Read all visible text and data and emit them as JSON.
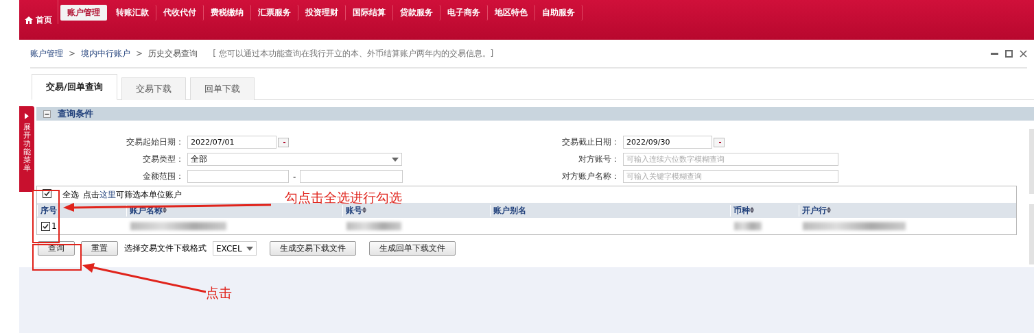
{
  "nav": {
    "home": "首页",
    "items": [
      {
        "label": "账户管理",
        "selected": true
      },
      {
        "label": "转账汇款",
        "selected": false
      },
      {
        "label": "代收代付",
        "selected": false
      },
      {
        "label": "费税缴纳",
        "selected": false
      },
      {
        "label": "汇票服务",
        "selected": false
      },
      {
        "label": "投资理财",
        "selected": false
      },
      {
        "label": "国际结算",
        "selected": false
      },
      {
        "label": "贷款服务",
        "selected": false
      },
      {
        "label": "电子商务",
        "selected": false
      },
      {
        "label": "地区特色",
        "selected": false
      },
      {
        "label": "自助服务",
        "selected": false
      }
    ]
  },
  "breadcrumb": {
    "items": [
      {
        "label": "账户管理",
        "link": true
      },
      {
        "label": "境内中行账户",
        "link": true
      },
      {
        "label": "历史交易查询",
        "link": false
      }
    ],
    "separators": [
      ">",
      ">"
    ],
    "hint": "[ 您可以通过本功能查询在我行开立的本、外币结算账户两年内的交易信息。]"
  },
  "tabs": [
    {
      "label": "交易/回单查询",
      "selected": true
    },
    {
      "label": "交易下载",
      "selected": false
    },
    {
      "label": "回单下载",
      "selected": false
    }
  ],
  "side_menu": {
    "label": "展开功能菜单"
  },
  "section": {
    "title": "查询条件"
  },
  "left_fields": [
    {
      "kind": "date",
      "label": "交易起始日期：",
      "value": "2022/07/01"
    },
    {
      "kind": "select",
      "label": "交易类型：",
      "value": "全部"
    },
    {
      "kind": "range",
      "label": "金额范围：",
      "separator": "-"
    }
  ],
  "right_fields": [
    {
      "kind": "date",
      "label": "交易截止日期：",
      "value": "2022/09/30"
    },
    {
      "kind": "text",
      "label": "对方账号：",
      "placeholder": "可输入连续六位数字模糊查询"
    },
    {
      "kind": "text",
      "label": "对方账户名称：",
      "placeholder": "可输入关键字模糊查询"
    }
  ],
  "accounts": {
    "select_all": {
      "label": "全选",
      "checked": true
    },
    "note_before": "点击",
    "note_link": "这里",
    "note_after": "可筛选本单位账户",
    "columns": [
      {
        "label": "序号",
        "sortable": false
      },
      {
        "label": "账户名称",
        "sortable": true
      },
      {
        "label": "账号",
        "sortable": true
      },
      {
        "label": "账户别名",
        "sortable": false
      },
      {
        "label": "币种",
        "sortable": true
      },
      {
        "label": "开户行",
        "sortable": true
      }
    ],
    "rows": [
      {
        "index": "1",
        "checked": true
      }
    ]
  },
  "actions": {
    "query": "查询",
    "reset": "重置",
    "format_label": "选择交易文件下载格式",
    "format": "EXCEL",
    "buttons": [
      "生成交易下载文件",
      "生成回单下载文件"
    ]
  },
  "annotations": {
    "select_hint": "勾点击全选进行勾选",
    "click_hint": "点击"
  }
}
